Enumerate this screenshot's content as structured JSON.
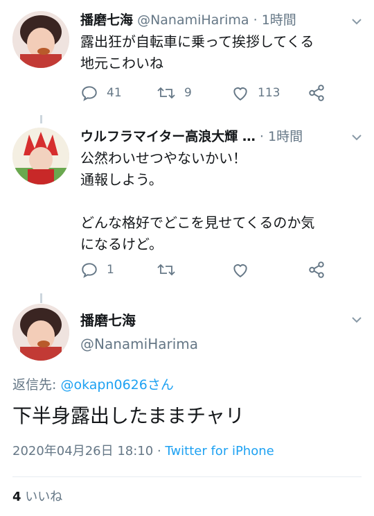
{
  "tweets": [
    {
      "name": "播磨七海",
      "handle": "@NanamiHarima",
      "separator": "·",
      "time": "1時間",
      "text": "露出狂が自転車に乗って挨拶してくる\n地元こわいね",
      "reply_count": "41",
      "retweet_count": "9",
      "like_count": "113"
    },
    {
      "name": "ウルフラマイター高浪大輝 …",
      "separator": "·",
      "time": "1時間",
      "text": "公然わいせつやないかい！\n通報しよう。\n\nどんな格好でどこを見せてくるのか気\nになるけど。",
      "reply_count": "1"
    }
  ],
  "main_tweet": {
    "name": "播磨七海",
    "handle": "@NanamiHarima",
    "reply_to_label": "返信先:",
    "reply_to_handle": "@okapn0626さん",
    "text": "下半身露出したままチャリ",
    "datetime": "2020年04月26日 18:10",
    "separator": "·",
    "source": "Twitter for iPhone",
    "like_count": "4",
    "like_label": "いいね"
  },
  "icons": [
    "chevron-down-icon",
    "reply-icon",
    "retweet-icon",
    "like-icon",
    "share-icon"
  ],
  "colors": {
    "text": "#14171a",
    "muted": "#657786",
    "link": "#1da1f2",
    "divider": "#e6ecf0"
  }
}
